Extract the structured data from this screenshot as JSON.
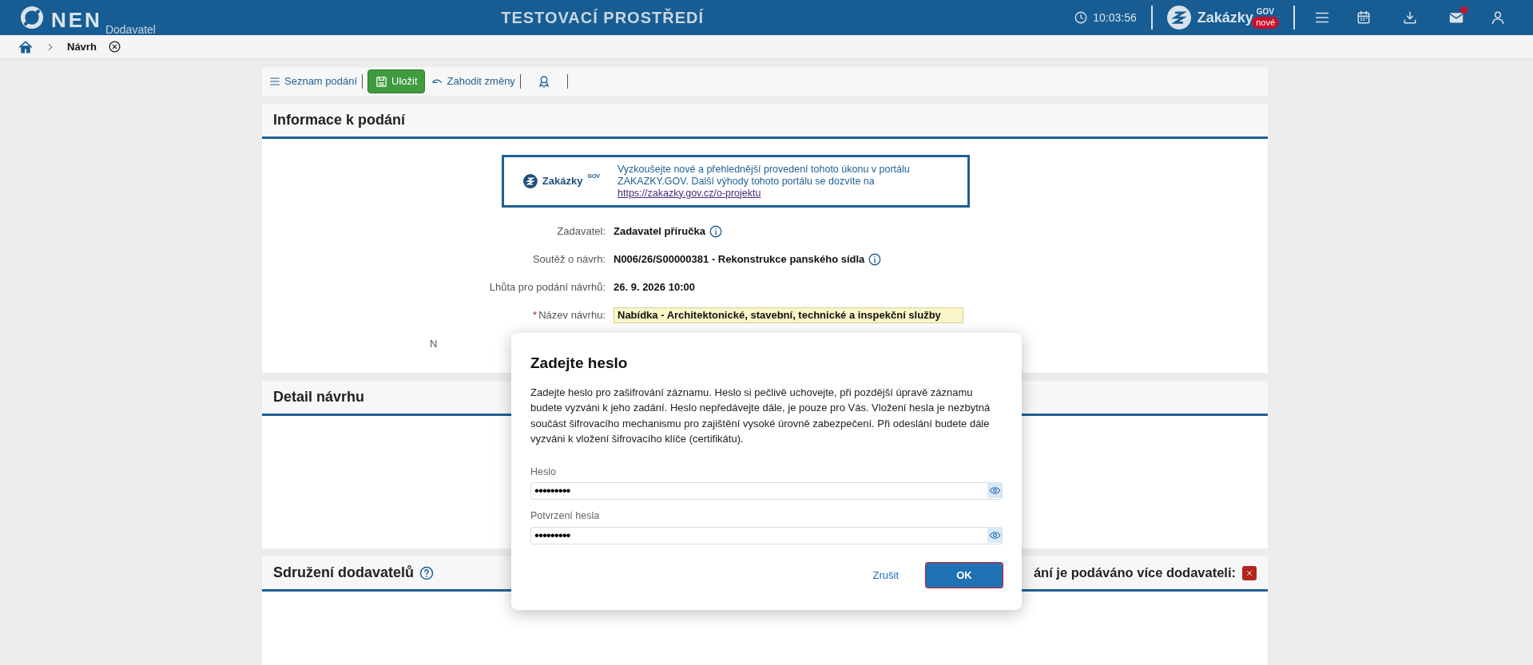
{
  "header": {
    "logo": "NEN",
    "subtitle": "Dodavatel",
    "environment": "TESTOVACÍ PROSTŘEDÍ",
    "time": "10:03:56",
    "portal": {
      "name": "Zakázky",
      "sup": "GOV",
      "badge": "nové"
    },
    "mail_unread": true
  },
  "breadcrumb": {
    "items": [
      "Návrh"
    ]
  },
  "toolbar": [
    {
      "kind": "link",
      "label": "Seznam podání"
    },
    {
      "kind": "primary",
      "label": "Uložit"
    },
    {
      "kind": "link",
      "label": "Zahodit změny"
    },
    {
      "kind": "icon"
    }
  ],
  "info_panel": {
    "title": "Informace k podání",
    "banner": {
      "brand": "Zakázky",
      "sup": "GOV",
      "text": "Vyzkoušejte nové a přehlednější provedení tohoto úkonu v portálu ZAKAZKY.GOV. Další výhody tohoto portálu se dozvíte na",
      "link": "https://zakazky.gov.cz/o-projektu"
    },
    "fields": [
      {
        "label": "Zadavatel:",
        "value": "Zadavatel příručka",
        "info": true,
        "kind": "text"
      },
      {
        "label": "Soutěž o návrh:",
        "value": "N006/26/S00000381 - Rekonstrukce panského sídla",
        "info": true,
        "kind": "text"
      },
      {
        "label": "Lhůta pro podání návrhů:",
        "value": "26. 9. 2026 10:00",
        "info": false,
        "kind": "text"
      },
      {
        "label": "Název návrhu:",
        "required_mark": "*",
        "value": "Nabídka - Architektonické, stavební, technické a inspekční služby",
        "kind": "input"
      },
      {
        "label": "N",
        "kind": "partial"
      }
    ]
  },
  "detail_panel": {
    "title": "Detail návrhu"
  },
  "association_panel": {
    "title": "Sdružení dodavatelů",
    "question": "ání je podáváno více dodavateli:",
    "answer": false
  },
  "dialog": {
    "title": "Zadejte heslo",
    "text": "Zadejte heslo pro zašifrování záznamu. Heslo si pečlivě uchovejte, při pozdější úpravě záznamu budete vyzváni k jeho zadání. Heslo nepředávejte dále, je pouze pro Vás. Vložení hesla je nezbytná součást šifrovacího mechanismu pro zajištění vysoké úrovně zabezpečení. Při odeslání budete dále vyzváni k vložení šifrovacího klíče (certifikátu).",
    "fields": [
      {
        "label": "Heslo",
        "value": "•••••••••"
      },
      {
        "label": "Potvrzení hesla",
        "value": "•••••••••"
      }
    ],
    "buttons": [
      {
        "kind": "secondary",
        "label": "Zrušit"
      },
      {
        "kind": "primary",
        "label": "OK",
        "focused": true
      }
    ]
  }
}
